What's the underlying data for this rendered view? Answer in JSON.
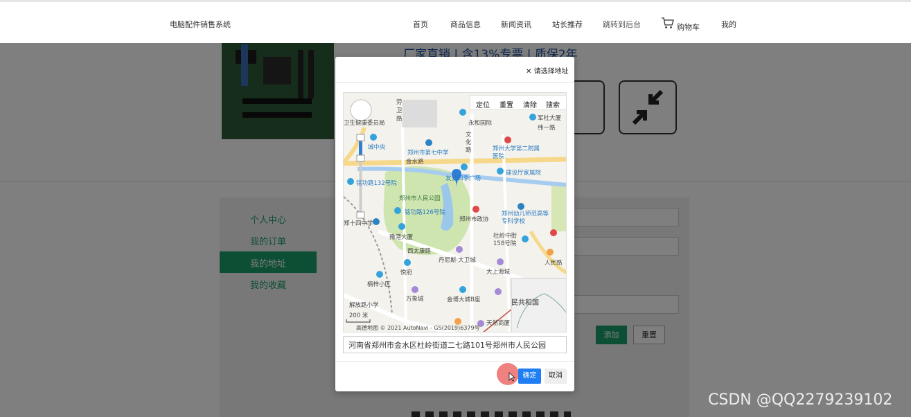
{
  "header": {
    "brand": "电脑配件销售系统",
    "nav": [
      "首页",
      "商品信息",
      "新闻资讯",
      "站长推荐",
      "跳转到后台",
      "购物车",
      "我的"
    ]
  },
  "banner": {
    "text": "厂家直销 | 含13%专票 | 质保2年"
  },
  "sidebar": {
    "items": [
      "个人中心",
      "我的订单",
      "我的地址",
      "我的收藏"
    ],
    "active_index": 2
  },
  "form": {
    "add_label": "添加",
    "reset_label": "重置"
  },
  "modal": {
    "title": "请选择地址",
    "toolbar": [
      "定位",
      "重置",
      "清除",
      "搜索"
    ],
    "map_labels": [
      "劳卫路",
      "卫生健康委员局",
      "永和国际",
      "军杜大厦",
      "纬一路",
      "城中央",
      "郑州市第七中学",
      "金水路",
      "文化路",
      "郑州大学第二附属医院",
      "建设厅家属院",
      "铭功路132号院",
      "友爱四季广场",
      "郑州市人民公园",
      "铭功路126号院",
      "郑州市政协",
      "郑州幼儿师范高等专科学校",
      "郑十四中学",
      "豫港大厦",
      "杜岭中街158号院",
      "西太康路",
      "丹尼斯·大卫城",
      "大上海城",
      "悦府",
      "楠梓小区",
      "万象城",
      "金博大城B座",
      "解放路小学",
      "天然商厦",
      "人民路",
      "民共和国",
      "200 米"
    ],
    "copyright": "高德地图 © 2021 AutoNavi - GS(2019)6379号",
    "address_value": "河南省郑州市金水区杜岭街道二七路101号郑州市人民公园",
    "ok_label": "确定",
    "cancel_label": "取消"
  },
  "watermark": "CSDN @QQ2279239102"
}
